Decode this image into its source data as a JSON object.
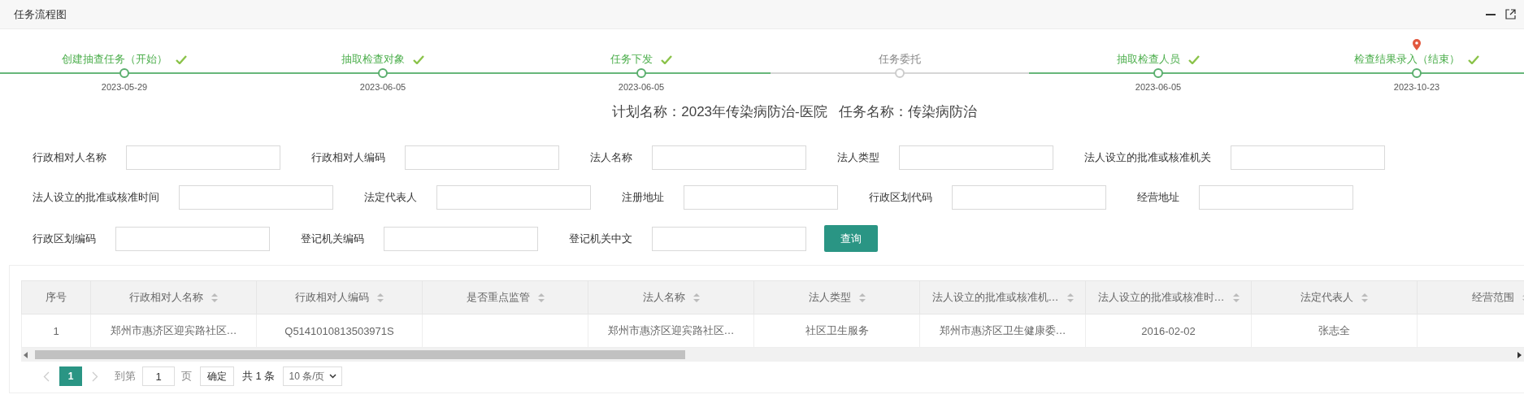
{
  "panel": {
    "title": "任务流程图"
  },
  "steps": [
    {
      "label": "创建抽查任务（开始）",
      "date": "2023-05-29",
      "done": true,
      "current": false
    },
    {
      "label": "抽取检查对象",
      "date": "2023-06-05",
      "done": true,
      "current": false
    },
    {
      "label": "任务下发",
      "date": "2023-06-05",
      "done": true,
      "current": false
    },
    {
      "label": "任务委托",
      "done": false,
      "current": false
    },
    {
      "label": "抽取检查人员",
      "date": "2023-06-05",
      "done": true,
      "current": false
    },
    {
      "label": "检查结果录入（结束）",
      "date": "2023-10-23",
      "done": true,
      "current": true
    }
  ],
  "summary": [
    "计划名称：2023年传染病防治-医院",
    "任务名称：传染病防治"
  ],
  "filters": [
    [
      {
        "label": "行政相对人名称"
      },
      {
        "label": "行政相对人编码"
      },
      {
        "label": "法人名称"
      },
      {
        "label": "法人类型"
      },
      {
        "label": "法人设立的批准或核准机关"
      }
    ],
    [
      {
        "label": "法人设立的批准或核准时间"
      },
      {
        "label": "法定代表人"
      },
      {
        "label": "注册地址"
      },
      {
        "label": "行政区划代码"
      },
      {
        "label": "经营地址"
      }
    ],
    [
      {
        "label": "行政区划编码"
      },
      {
        "label": "登记机关编码"
      },
      {
        "label": "登记机关中文"
      }
    ]
  ],
  "query_button": "查询",
  "table": {
    "columns": [
      {
        "label": "序号",
        "sortable": false
      },
      {
        "label": "行政相对人名称",
        "sortable": true
      },
      {
        "label": "行政相对人编码",
        "sortable": true
      },
      {
        "label": "是否重点监管",
        "sortable": true
      },
      {
        "label": "法人名称",
        "sortable": true
      },
      {
        "label": "法人类型",
        "sortable": true
      },
      {
        "label": "法人设立的批准或核准机…",
        "sortable": true
      },
      {
        "label": "法人设立的批准或核准时…",
        "sortable": true
      },
      {
        "label": "法定代表人",
        "sortable": true
      },
      {
        "label": "经营范围",
        "sortable": true
      }
    ],
    "rows": [
      {
        "cells": [
          "1",
          "郑州市惠济区迎宾路社区…",
          "Q5141010813503971S",
          null,
          "郑州市惠济区迎宾路社区…",
          "社区卫生服务",
          "郑州市惠济区卫生健康委…",
          "2016-02-02",
          "张志全",
          null
        ]
      }
    ]
  },
  "pagination": {
    "pages": [
      {
        "label": "1",
        "selected": true
      }
    ],
    "goto_label": "到第",
    "goto_value": "1",
    "page_unit": "页",
    "confirm": "确定",
    "total": "共 1 条",
    "page_size": "10 条/页"
  }
}
